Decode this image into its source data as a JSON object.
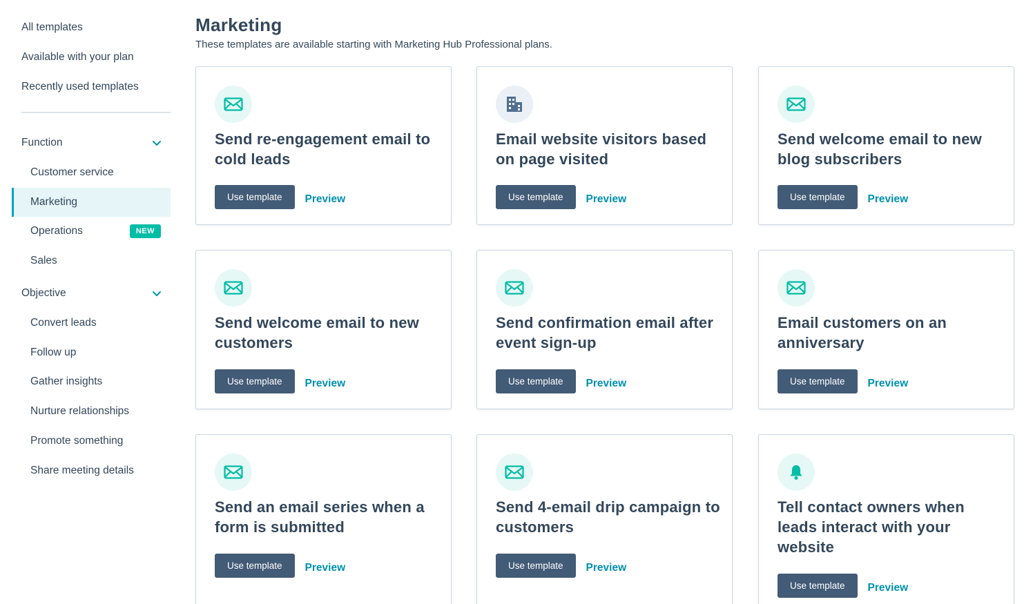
{
  "sidebar": {
    "top_links": [
      "All templates",
      "Available with your plan",
      "Recently used templates"
    ],
    "function": {
      "label": "Function",
      "items": [
        {
          "label": "Customer service"
        },
        {
          "label": "Marketing",
          "active": true
        },
        {
          "label": "Operations",
          "badge": "NEW"
        },
        {
          "label": "Sales"
        }
      ]
    },
    "objective": {
      "label": "Objective",
      "items": [
        {
          "label": "Convert leads"
        },
        {
          "label": "Follow up"
        },
        {
          "label": "Gather insights"
        },
        {
          "label": "Nurture relationships"
        },
        {
          "label": "Promote something"
        },
        {
          "label": "Share meeting details"
        }
      ]
    }
  },
  "main": {
    "title": "Marketing",
    "subtitle": "These templates are available starting with Marketing Hub Professional plans.",
    "use_label": "Use template",
    "preview_label": "Preview",
    "cards": [
      {
        "icon": "email-icon",
        "title": "Send re-engagement email to cold leads"
      },
      {
        "icon": "building-icon",
        "title": "Email website visitors based on page visited"
      },
      {
        "icon": "email-icon",
        "title": "Send welcome email to new blog subscribers"
      },
      {
        "icon": "email-icon",
        "title": "Send welcome email to new customers"
      },
      {
        "icon": "email-icon",
        "title": "Send confirmation email after event sign-up"
      },
      {
        "icon": "email-icon",
        "title": "Email customers on an anniversary"
      },
      {
        "icon": "email-icon",
        "title": "Send an email series when a form is submitted"
      },
      {
        "icon": "email-icon",
        "title": "Send 4-email drip campaign to customers"
      },
      {
        "icon": "bell-icon",
        "title": "Tell contact owners when leads interact with your website"
      }
    ]
  },
  "colors": {
    "accent_teal": "#00bda5",
    "button_slate": "#425b76",
    "link_blue": "#0091ae",
    "active_bg": "#e5f5f8"
  }
}
